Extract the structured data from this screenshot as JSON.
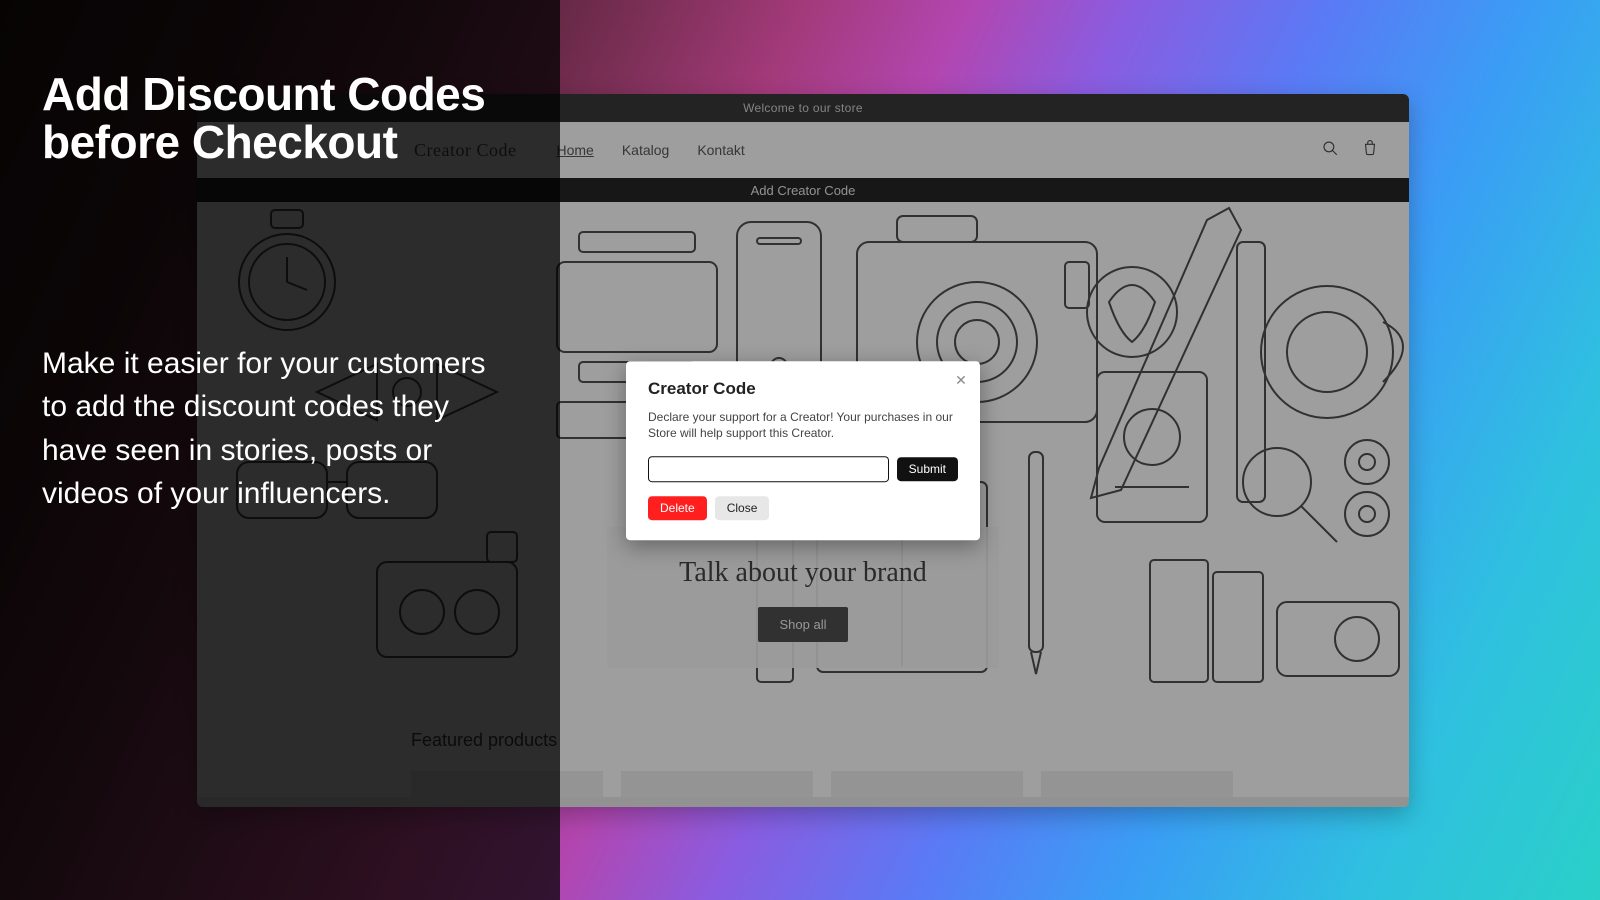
{
  "promo": {
    "title_line1": "Add Discount Codes",
    "title_line2": "before Checkout",
    "body": "Make it easier for your customers to add the discount codes they have seen in stories, posts or videos of your influencers."
  },
  "store": {
    "announce": "Welcome to our store",
    "logo": "Creator Code",
    "nav": {
      "home": "Home",
      "katalog": "Katalog",
      "kontakt": "Kontakt"
    },
    "creator_bar": "Add Creator Code",
    "hero": {
      "headline": "Talk about your brand",
      "cta": "Shop all"
    },
    "featured": {
      "heading": "Featured products"
    }
  },
  "modal": {
    "title": "Creator Code",
    "description": "Declare your support for a Creator! Your purchases in our Store will help support this Creator.",
    "input_value": "",
    "submit": "Submit",
    "delete": "Delete",
    "close": "Close"
  }
}
